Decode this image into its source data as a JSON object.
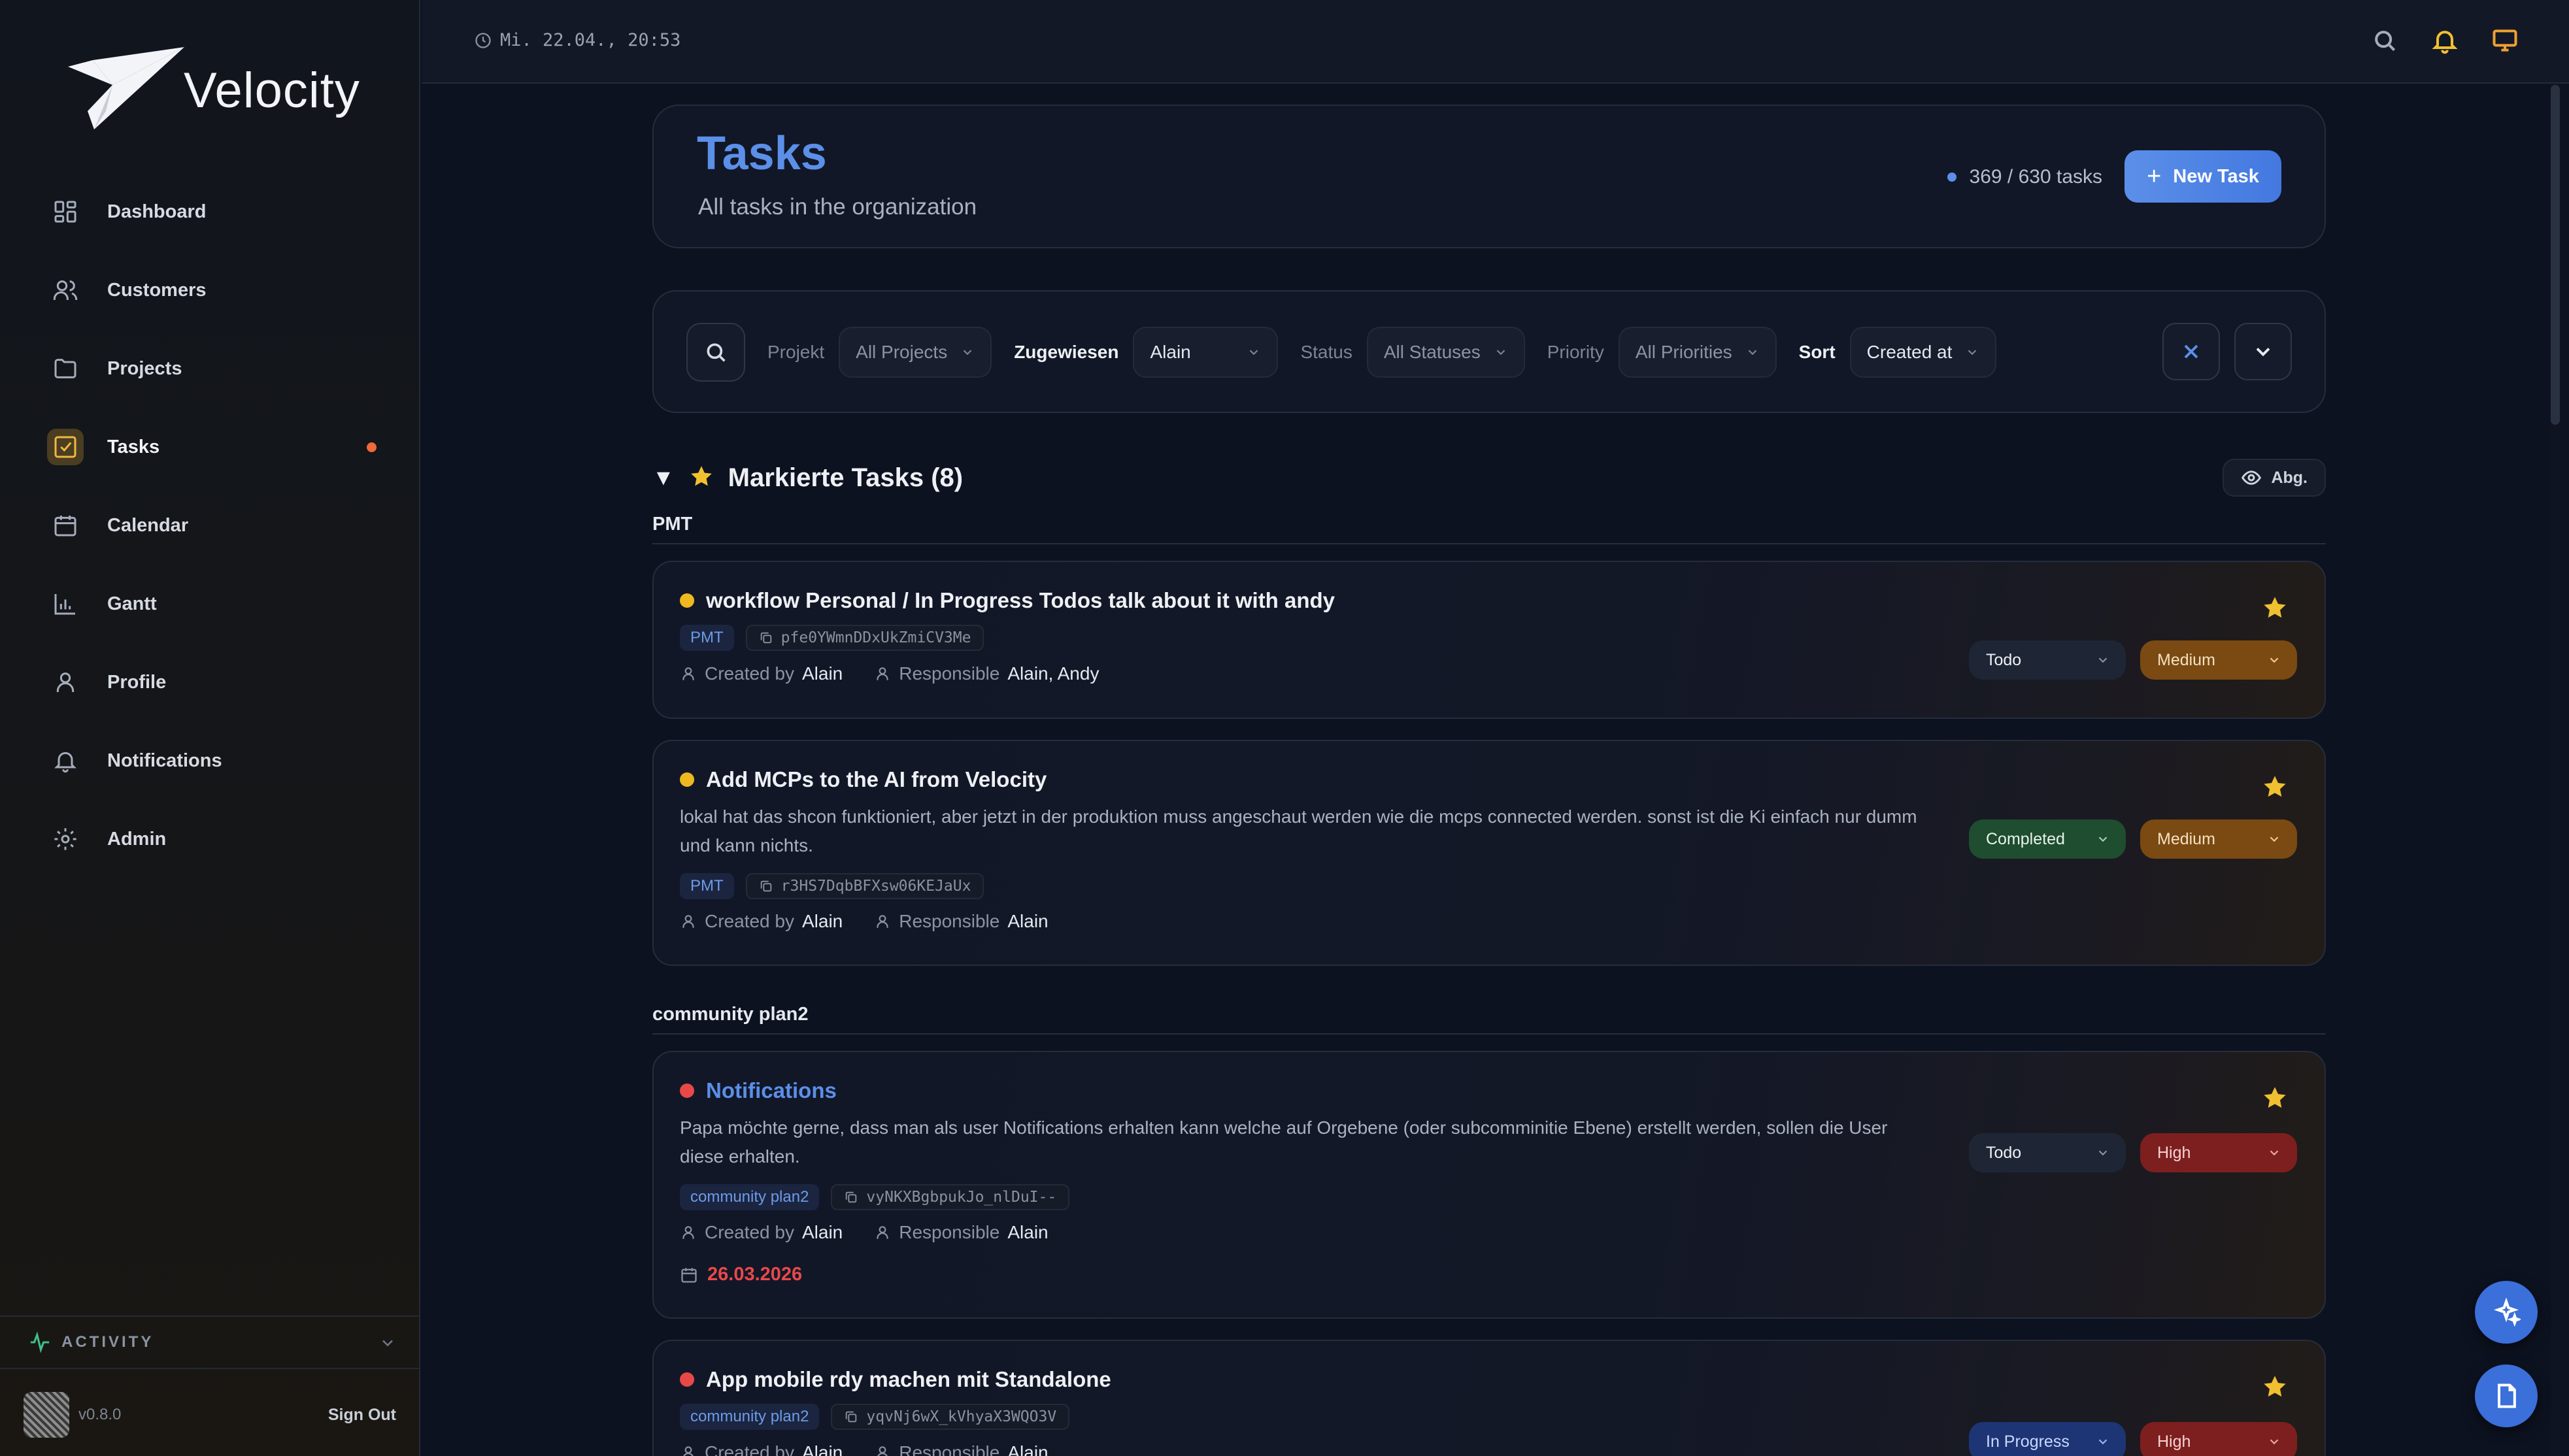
{
  "app": {
    "name": "Velocity",
    "version": "v0.8.0",
    "sign_out": "Sign Out"
  },
  "sidebar": {
    "items": [
      {
        "label": "Dashboard",
        "icon": "dashboard-icon"
      },
      {
        "label": "Customers",
        "icon": "users-icon"
      },
      {
        "label": "Projects",
        "icon": "folder-icon"
      },
      {
        "label": "Tasks",
        "icon": "checkbox-icon",
        "active": true,
        "badge_color": "#f06a3a"
      },
      {
        "label": "Calendar",
        "icon": "calendar-icon"
      },
      {
        "label": "Gantt",
        "icon": "bar-chart-icon"
      },
      {
        "label": "Profile",
        "icon": "user-icon"
      },
      {
        "label": "Notifications",
        "icon": "bell-icon"
      },
      {
        "label": "Admin",
        "icon": "gear-icon"
      }
    ],
    "activity_label": "ACTIVITY"
  },
  "topbar": {
    "datetime": "Mi. 22.04., 20:53"
  },
  "header": {
    "title": "Tasks",
    "subtitle": "All tasks in the organization",
    "count": "369 / 630 tasks",
    "new_task": "New Task"
  },
  "filters": {
    "project_label": "Projekt",
    "project_value": "All Projects",
    "assigned_label": "Zugewiesen",
    "assigned_value": "Alain",
    "status_label": "Status",
    "status_value": "All Statuses",
    "priority_label": "Priority",
    "priority_value": "All Priorities",
    "sort_label": "Sort",
    "sort_value": "Created at"
  },
  "section": {
    "title": "Markierte Tasks (8)",
    "toggle_label": "Abg."
  },
  "groups": [
    {
      "label": "PMT"
    },
    {
      "label": "community plan2"
    }
  ],
  "labels": {
    "created_by": "Created by",
    "responsible": "Responsible"
  },
  "tasks": [
    {
      "title": "workflow Personal / In Progress Todos talk about it with andy",
      "priority_dot": "#f0b820",
      "tag": "PMT",
      "hash": "pfe0YWmnDDxUkZmiCV3Me",
      "created_by": "Alain",
      "responsible": "Alain, Andy",
      "status": "Todo",
      "priority": "Medium"
    },
    {
      "title": "Add MCPs to the AI from Velocity",
      "priority_dot": "#f0b820",
      "description": "lokal hat das shcon funktioniert, aber jetzt in der produktion muss angeschaut werden wie die mcps connected werden. sonst ist die Ki einfach nur dumm und kann nichts.",
      "tag": "PMT",
      "hash": "r3HS7DqbBFXsw06KEJaUx",
      "created_by": "Alain",
      "responsible": "Alain",
      "status": "Completed",
      "priority": "Medium"
    },
    {
      "title": "Notifications",
      "priority_dot": "#e94848",
      "description": "Papa möchte gerne, dass man als user Notifications erhalten kann welche auf Orgebene (oder subcomminitie Ebene) erstellt werden, sollen die User diese erhalten.",
      "tag": "community plan2",
      "hash": "vyNKXBgbpukJo_nlDuI--",
      "created_by": "Alain",
      "responsible": "Alain",
      "due_date": "26.03.2026",
      "status": "Todo",
      "priority": "High"
    },
    {
      "title": "App mobile rdy machen mit Standalone",
      "priority_dot": "#e94848",
      "tag": "community plan2",
      "hash": "yqvNj6wX_kVhyaX3WQO3V",
      "created_by": "Alain",
      "responsible": "Alain",
      "status": "In Progress",
      "priority": "High"
    }
  ]
}
